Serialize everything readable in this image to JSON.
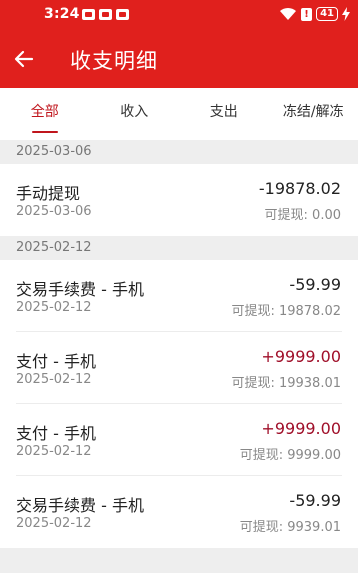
{
  "status_bar": {
    "time": "3:24",
    "battery": "41"
  },
  "app_bar": {
    "title": "收支明细"
  },
  "tabs": [
    {
      "label": "全部",
      "active": true
    },
    {
      "label": "收入",
      "active": false
    },
    {
      "label": "支出",
      "active": false
    },
    {
      "label": "冻结/解冻",
      "active": false
    }
  ],
  "groups": [
    {
      "date": "2025-03-06",
      "records": [
        {
          "title": "手动提现",
          "date": "2025-03-06",
          "amount": "-19878.02",
          "balance": "可提现: 0.00",
          "positive": false
        }
      ]
    },
    {
      "date": "2025-02-12",
      "records": [
        {
          "title": "交易手续费 - 手机",
          "date": "2025-02-12",
          "amount": "-59.99",
          "balance": "可提现: 19878.02",
          "positive": false
        },
        {
          "title": "支付 - 手机",
          "date": "2025-02-12",
          "amount": "+9999.00",
          "balance": "可提现: 19938.01",
          "positive": true
        },
        {
          "title": "支付 - 手机",
          "date": "2025-02-12",
          "amount": "+9999.00",
          "balance": "可提现: 9999.00",
          "positive": true
        },
        {
          "title": "交易手续费 - 手机",
          "date": "2025-02-12",
          "amount": "-59.99",
          "balance": "可提现: 9939.01",
          "positive": false
        }
      ]
    }
  ],
  "colors": {
    "brand": "#e0201d",
    "accent": "#c0151c",
    "positive_amount": "#a0102a"
  }
}
